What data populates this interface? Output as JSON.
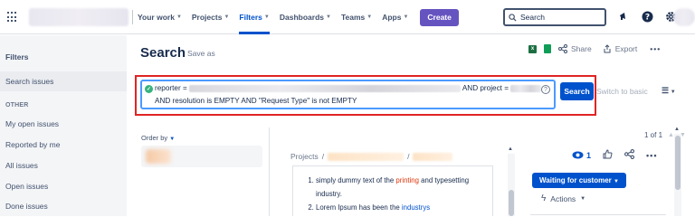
{
  "topnav": {
    "items": [
      {
        "label": "Your work"
      },
      {
        "label": "Projects"
      },
      {
        "label": "Filters"
      },
      {
        "label": "Dashboards"
      },
      {
        "label": "Teams"
      },
      {
        "label": "Apps"
      }
    ],
    "create_label": "Create",
    "search_placeholder": "Search",
    "accent": "#0052cc",
    "create_color": "#6554c0"
  },
  "sidebar": {
    "title": "Filters",
    "search_issues": "Search issues",
    "section_other": "OTHER",
    "items": [
      {
        "label": "My open issues"
      },
      {
        "label": "Reported by me"
      },
      {
        "label": "All issues"
      },
      {
        "label": "Open issues"
      },
      {
        "label": "Done issues"
      }
    ]
  },
  "header": {
    "title": "Search",
    "save_as": "Save as",
    "share": "Share",
    "export": "Export"
  },
  "jql": {
    "prefix": "reporter = ",
    "suffix": " AND project = ",
    "line2": "AND resolution is EMPTY AND \"Request Type\" is not EMPTY",
    "search_button": "Search",
    "switch_basic": "Switch to basic"
  },
  "results": {
    "order_by": "Order by",
    "pagination": "1 of 1",
    "breadcrumb_root": "Projects",
    "breadcrumb_sep": "/"
  },
  "issue": {
    "description_items": [
      {
        "pre": "simply dummy text of the ",
        "hl": "printing",
        "post": " and typesetting industry."
      },
      {
        "pre": "Lorem Ipsum has been the ",
        "link": "industrys"
      }
    ],
    "watchers": "1",
    "status": "Waiting for customer",
    "actions": "Actions"
  }
}
